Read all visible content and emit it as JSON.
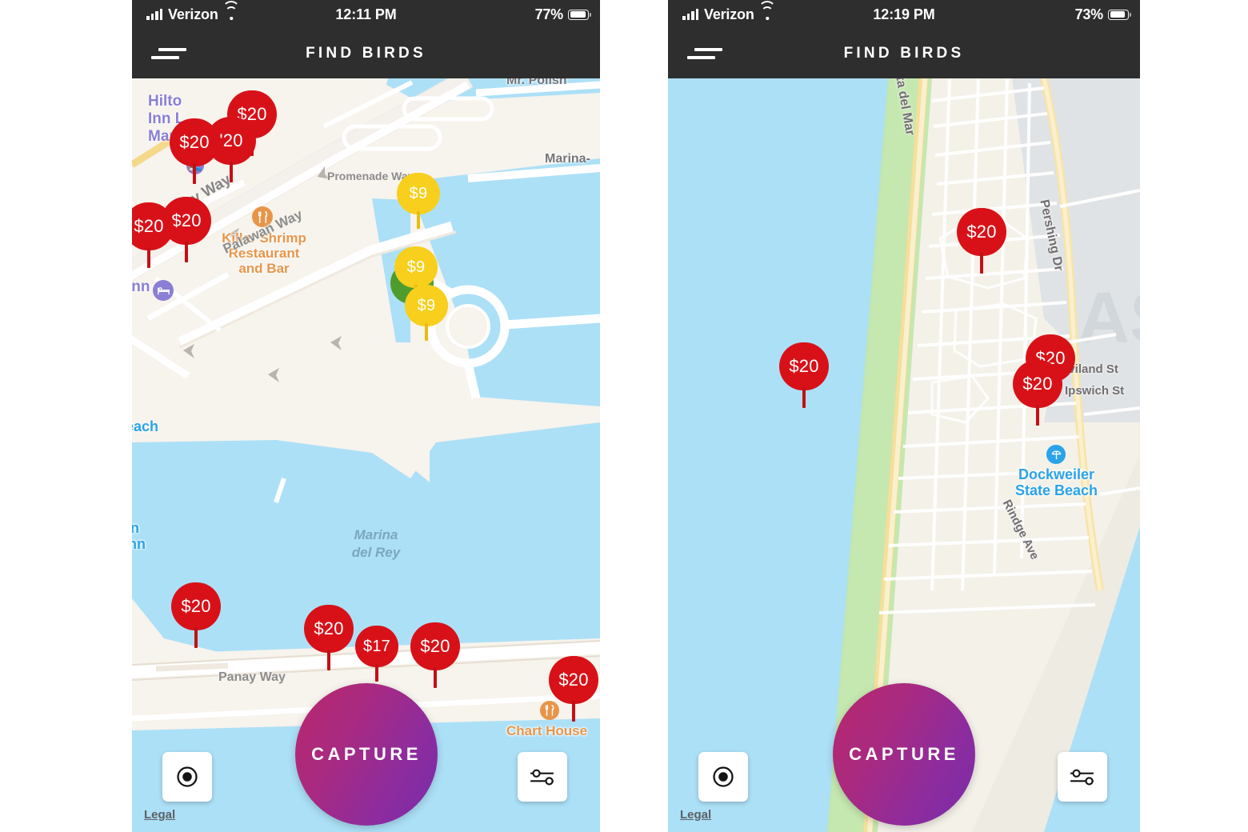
{
  "screens": [
    {
      "id": "left",
      "status_bar": {
        "carrier": "Verizon",
        "time": "12:11 PM",
        "battery_percent": "77%",
        "signal_icon": "cellular-bars-icon",
        "wifi_icon": "wifi-icon",
        "location_icon": "location-arrow-icon",
        "battery_icon": "battery-icon"
      },
      "nav": {
        "menu_icon": "hamburger-menu-icon",
        "title": "FIND BIRDS"
      },
      "map": {
        "area_label": "Marina del Rey",
        "labels": [
          {
            "text": "Mr. Polish",
            "type": "grey"
          },
          {
            "text": "Marina-",
            "type": "grey"
          },
          {
            "text": "Hilton\nInn L\nMar",
            "type": "hotel"
          },
          {
            "text": "Killer Shrimp\nRestaurant\nand Bar",
            "type": "poi"
          },
          {
            "text": "Chart House",
            "type": "poi"
          },
          {
            "text": "Inn",
            "type": "hotel"
          },
          {
            "text": "each",
            "type": "beach"
          },
          {
            "text": "n\nInn",
            "type": "beach"
          },
          {
            "text": "Marina\ndel Rey",
            "type": "water"
          }
        ],
        "streets": [
          "Promenade Way",
          "y Way",
          "Palawan Way",
          "Panay Way"
        ],
        "pins": [
          {
            "price": "$20",
            "color": "red"
          },
          {
            "price": "'20",
            "color": "red"
          },
          {
            "price": "$20",
            "color": "red"
          },
          {
            "price": "$20",
            "color": "red"
          },
          {
            "price": "$20",
            "color": "red"
          },
          {
            "price": "$9",
            "color": "yellow"
          },
          {
            "price": "$9",
            "color": "yellow"
          },
          {
            "price": "$9",
            "color": "yellow"
          },
          {
            "price": "",
            "color": "green"
          },
          {
            "price": "$20",
            "color": "red"
          },
          {
            "price": "$20",
            "color": "red"
          },
          {
            "price": "$17",
            "color": "red"
          },
          {
            "price": "$20",
            "color": "red"
          },
          {
            "price": "$20",
            "color": "red"
          }
        ]
      },
      "controls": {
        "locate_icon": "current-location-icon",
        "capture_label": "CAPTURE",
        "filter_icon": "filter-sliders-icon",
        "legal_label": "Legal"
      }
    },
    {
      "id": "right",
      "status_bar": {
        "carrier": "Verizon",
        "time": "12:19 PM",
        "battery_percent": "73%",
        "signal_icon": "cellular-bars-icon",
        "wifi_icon": "wifi-icon",
        "location_icon": "location-arrow-icon",
        "battery_icon": "battery-icon"
      },
      "nav": {
        "menu_icon": "hamburger-menu-icon",
        "title": "FIND BIRDS"
      },
      "map": {
        "area_label": "Dockweiler State Beach",
        "labels": [
          {
            "text": "Dockweiler\nState Beach",
            "type": "beach"
          },
          {
            "text": "aviland St",
            "type": "street"
          },
          {
            "text": "Ipswich St",
            "type": "street"
          }
        ],
        "streets": [
          "ta del Mar",
          "Pershing Dr",
          "Rindge Ave"
        ],
        "pins": [
          {
            "price": "$20",
            "color": "red"
          },
          {
            "price": "$20",
            "color": "red"
          },
          {
            "price": "$20",
            "color": "red"
          },
          {
            "price": "$20",
            "color": "red"
          }
        ]
      },
      "controls": {
        "locate_icon": "current-location-icon",
        "capture_label": "CAPTURE",
        "filter_icon": "filter-sliders-icon",
        "legal_label": "Legal"
      }
    }
  ]
}
